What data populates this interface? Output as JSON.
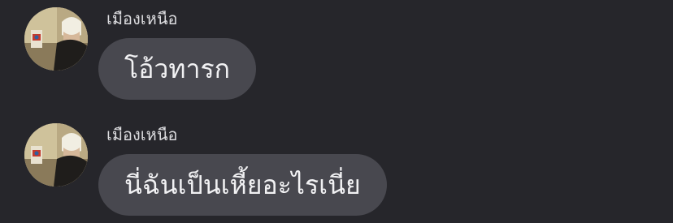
{
  "messages": [
    {
      "sender": "เมืองเหนือ",
      "text": "โอ้วทารก",
      "avatar_icon": "user-avatar-photo"
    },
    {
      "sender": "เมืองเหนือ",
      "text": "นี่ฉันเป็นเหี้ยอะไรเนี่ย",
      "avatar_icon": "user-avatar-photo"
    }
  ],
  "colors": {
    "background": "#26262b",
    "bubble": "#48484f",
    "bubble_text": "#f1f1f3",
    "sender_text": "#dcdcdf"
  }
}
